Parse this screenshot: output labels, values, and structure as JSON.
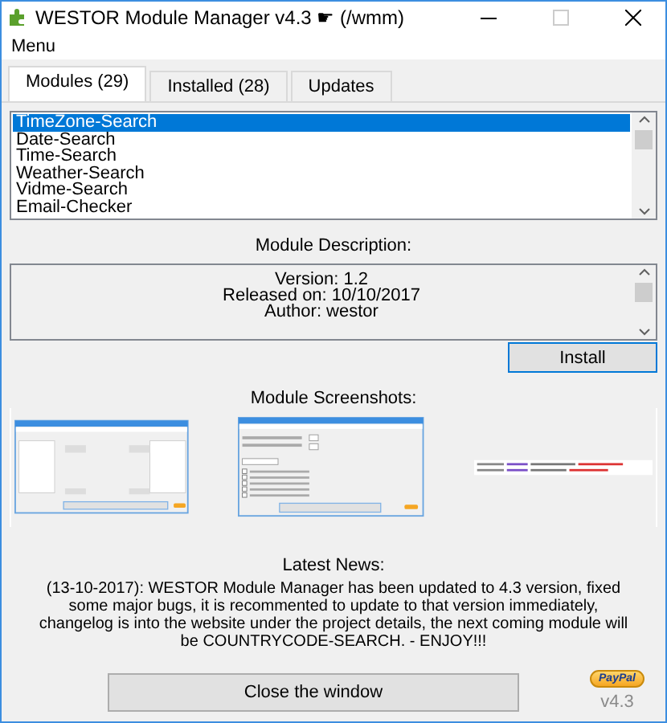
{
  "window": {
    "title": "WESTOR Module Manager v4.3 ☛ (/wmm)"
  },
  "menu": [
    "Menu"
  ],
  "tabs": [
    {
      "label": "Modules (29)",
      "selected": true
    },
    {
      "label": "Installed (28)",
      "selected": false
    },
    {
      "label": "Updates",
      "selected": false
    }
  ],
  "modules": [
    {
      "name": "TimeZone-Search",
      "selected": true
    },
    {
      "name": "Date-Search",
      "selected": false
    },
    {
      "name": "Time-Search",
      "selected": false
    },
    {
      "name": "Weather-Search",
      "selected": false
    },
    {
      "name": "Vidme-Search",
      "selected": false
    },
    {
      "name": "Email-Checker",
      "selected": false
    }
  ],
  "description": {
    "title": "Module Description:",
    "lines": [
      "Version: 1.2",
      "Released on: 10/10/2017",
      "Author: westor"
    ]
  },
  "install_button": "Install",
  "screenshots": {
    "title": "Module Screenshots:",
    "items": [
      {
        "kind": "lists"
      },
      {
        "kind": "settings"
      },
      {
        "kind": "log"
      }
    ]
  },
  "news": {
    "title": "Latest News:",
    "text": "(13-10-2017): WESTOR Module Manager has been updated to 4.3 version, fixed some major bugs, it is recommented to update to that version immediately, changelog is into the website under the project details, the next coming module will be COUNTRYCODE-SEARCH. - ENJOY!!!"
  },
  "close_button": "Close the window",
  "donate": "PayPal",
  "version": "v4.3"
}
